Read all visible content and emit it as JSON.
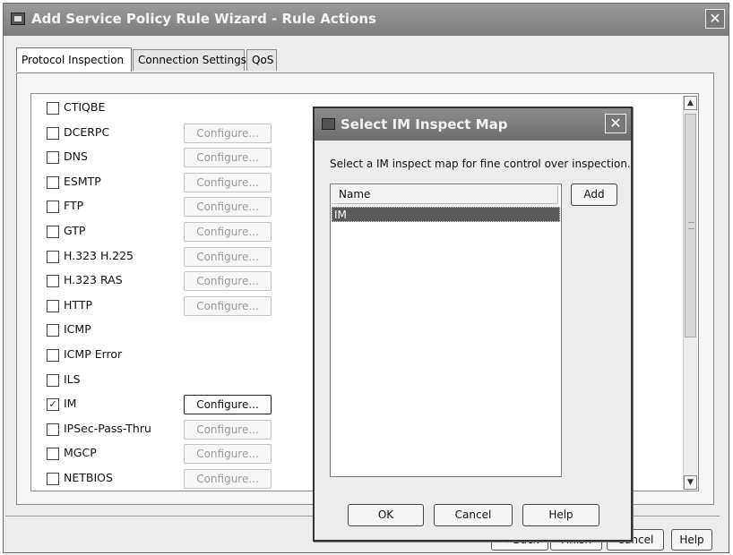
{
  "window": {
    "title": "Add Service Policy Rule Wizard - Rule Actions",
    "close_glyph": "✕"
  },
  "tabs": [
    {
      "label": "Protocol Inspection",
      "active": true
    },
    {
      "label": "Connection Settings",
      "active": false
    },
    {
      "label": "QoS",
      "active": false
    }
  ],
  "protocols": [
    {
      "label": "CTIQBE",
      "checked": false,
      "configure": null
    },
    {
      "label": "DCERPC",
      "checked": false,
      "configure": "Configure..."
    },
    {
      "label": "DNS",
      "checked": false,
      "configure": "Configure..."
    },
    {
      "label": "ESMTP",
      "checked": false,
      "configure": "Configure..."
    },
    {
      "label": "FTP",
      "checked": false,
      "configure": "Configure..."
    },
    {
      "label": "GTP",
      "checked": false,
      "configure": "Configure..."
    },
    {
      "label": "H.323 H.225",
      "checked": false,
      "configure": "Configure..."
    },
    {
      "label": "H.323 RAS",
      "checked": false,
      "configure": "Configure..."
    },
    {
      "label": "HTTP",
      "checked": false,
      "configure": "Configure..."
    },
    {
      "label": "ICMP",
      "checked": false,
      "configure": null
    },
    {
      "label": "ICMP Error",
      "checked": false,
      "configure": null
    },
    {
      "label": "ILS",
      "checked": false,
      "configure": null
    },
    {
      "label": "IM",
      "checked": true,
      "configure": "Configure..."
    },
    {
      "label": "IPSec-Pass-Thru",
      "checked": false,
      "configure": "Configure..."
    },
    {
      "label": "MGCP",
      "checked": false,
      "configure": "Configure..."
    },
    {
      "label": "NETBIOS",
      "checked": false,
      "configure": "Configure..."
    }
  ],
  "footer_buttons": {
    "back": "< Back",
    "finish": "Finish",
    "cancel": "Cancel",
    "help": "Help"
  },
  "dialog": {
    "title": "Select IM Inspect Map",
    "close_glyph": "✕",
    "description": "Select a IM inspect map for fine control over inspection.",
    "column_name": "Name",
    "maps": [
      "IM"
    ],
    "add_label": "Add",
    "ok_label": "OK",
    "cancel_label": "Cancel",
    "help_label": "Help"
  },
  "icons": {
    "checkmark": "✓",
    "scroll_up": "▲",
    "scroll_down": "▼"
  }
}
